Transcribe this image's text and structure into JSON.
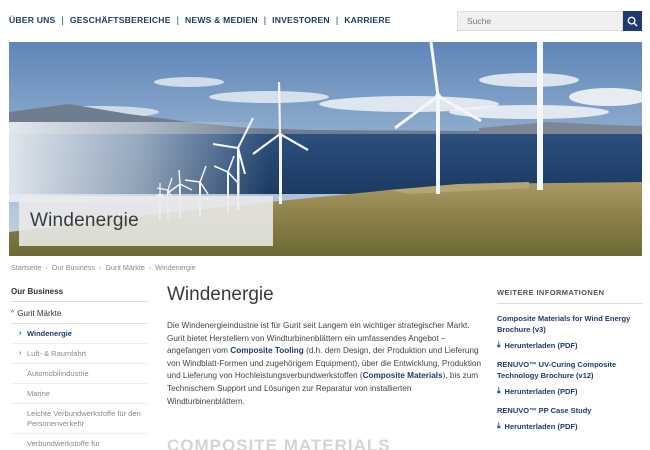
{
  "topnav": {
    "items": [
      "ÜBER UNS",
      "GESCHÄFTSBEREICHE",
      "NEWS & MEDIEN",
      "INVESTOREN",
      "KARRIERE"
    ],
    "separator": "|"
  },
  "search": {
    "placeholder": "Suche",
    "icon": "search-icon"
  },
  "hero": {
    "title": "Windenergie"
  },
  "breadcrumb": {
    "items": [
      "Startseite",
      "Our Business",
      "Gurit Märkte",
      "Windenergie"
    ],
    "separator": "›"
  },
  "sidebar": {
    "heading": "Our Business",
    "section": "Gurit Märkte",
    "items": [
      {
        "label": "Windenergie",
        "active": true
      },
      {
        "label": "Luft- & Raumfahrt",
        "active": false
      },
      {
        "label": "Automobilindustrie",
        "active": false
      },
      {
        "label": "Marine",
        "active": false
      },
      {
        "label": "Leichte Verbundwerkstoffe für den Personenverkehr",
        "active": false
      },
      {
        "label": "Verbundwerkstoffe für Industrieanwendungen",
        "active": false
      }
    ]
  },
  "main": {
    "title": "Windenergie",
    "p1": "Die Windenergieindustrie ist für Gurit seit Langem ein wichtiger strategischer Markt. Gurit bietet Herstellern von Windturbinenblättern ein umfassendes Angebot – angefangen vom ",
    "link1": "Composite Tooling",
    "p2": " (d.h. dem Design, der Produktion und Lieferung von Windblatt-Formen und zugehörigem Equipment), über die Entwicklung, Produktion und Lieferung von Hochleistungsverbundwerkstoffen (",
    "link2": "Composite Materials",
    "p3": "), bis zum Technischem Support und Lösungen zur Reparatur von installierten Windturbinenblättern.",
    "next_heading": "COMPOSITE MATERIALS"
  },
  "info": {
    "heading": "WEITERE INFORMATIONEN",
    "docs": [
      {
        "title": "Composite Materials for Wind Energy Brochure (v3)",
        "link": "Herunterladen (PDF)"
      },
      {
        "title": "RENUVO™ UV-Curing Composite Technology Brochure (v12)",
        "link": "Herunterladen (PDF)"
      },
      {
        "title": "RENUVO™ PP Case Study",
        "link": "Herunterladen (PDF)"
      }
    ]
  },
  "colors": {
    "brand": "#1e3a6e",
    "text": "#444444",
    "muted": "#888888"
  }
}
